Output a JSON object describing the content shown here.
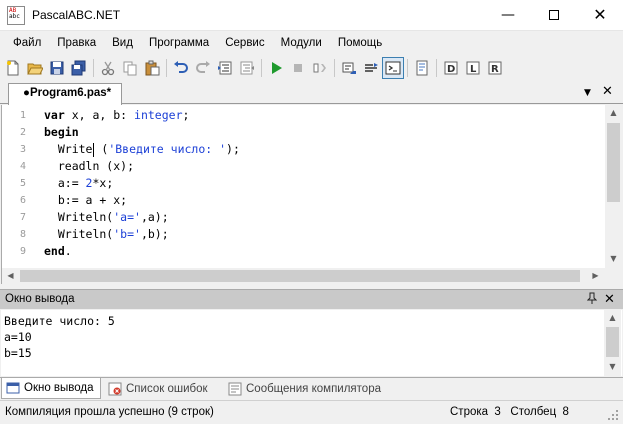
{
  "window": {
    "title": "PascalABC.NET",
    "minimize_glyph": "—",
    "close_glyph": "✕",
    "icon_line1": "AB",
    "icon_line2": "abc"
  },
  "menu": [
    "Файл",
    "Правка",
    "Вид",
    "Программа",
    "Сервис",
    "Модули",
    "Помощь"
  ],
  "toolbar": {
    "icons": [
      "new-file-icon",
      "open-folder-icon",
      "save-icon",
      "save-all-icon",
      "cut-icon",
      "copy-icon",
      "paste-icon",
      "undo-icon",
      "redo-icon",
      "indent-icon",
      "outdent-icon",
      "run-icon",
      "stop-icon",
      "step-icon",
      "step-over-icon",
      "console-window-icon",
      "form-designer-icon",
      "debug-icon",
      "release-icon",
      "restore-icon"
    ]
  },
  "tab": {
    "label": "●Program6.pas*",
    "dropdown_glyph": "▼",
    "close_glyph": "✕"
  },
  "editor": {
    "line_numbers": [
      "1",
      "2",
      "3",
      "4",
      "5",
      "6",
      "7",
      "8",
      "9"
    ],
    "code": {
      "l1_kw": "var",
      "l1_rest": " x, a, b: ",
      "l1_type": "integer",
      "l1_end": ";",
      "l2_kw": "begin",
      "l3_a": "  Write",
      "l3_b": " (",
      "l3_str": "'Введите число: '",
      "l3_end": ");",
      "l4": "  readln (x);",
      "l5_a": "  a:= ",
      "l5_num": "2",
      "l5_b": "*x;",
      "l6": "  b:= a + x;",
      "l7_a": "  Writeln(",
      "l7_str": "'a='",
      "l7_b": ",a);",
      "l8_a": "  Writeln(",
      "l8_str": "'b='",
      "l8_b": ",b);",
      "l9_kw": "end",
      "l9_end": "."
    },
    "scroll_up": "▲",
    "scroll_down": "▼",
    "scroll_left": "◀",
    "scroll_right": "▶"
  },
  "output_panel": {
    "title": "Окно вывода",
    "pin_glyph": "📌",
    "close_glyph": "✕",
    "lines": [
      "Введите число: 5",
      "a=10",
      "b=15"
    ]
  },
  "bottom_tabs": [
    "Окно вывода",
    "Список ошибок",
    "Сообщения компилятора"
  ],
  "status": {
    "message": "Компиляция прошла успешно (9 строк)",
    "position": "Строка  3   Столбец  8"
  }
}
